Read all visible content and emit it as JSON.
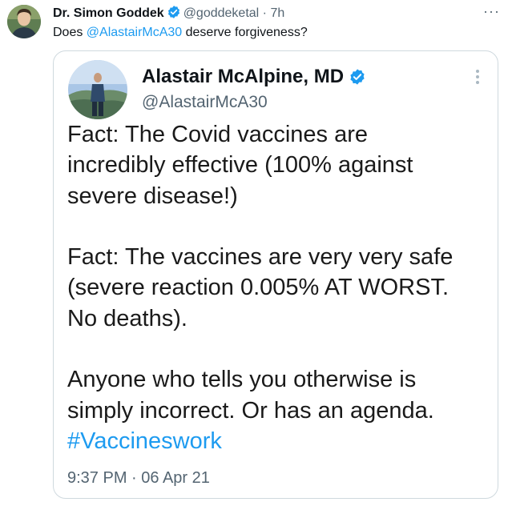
{
  "tweet": {
    "author_name": "Dr. Simon Goddek",
    "handle": "@goddeketal",
    "separator": "·",
    "time": "7h",
    "more_icon": "···",
    "text_before": "Does ",
    "mention": "@AlastairMcA30",
    "text_after": " deserve forgiveness?"
  },
  "quoted": {
    "author_name": "Alastair McAlpine, MD",
    "handle": "@AlastairMcA30",
    "paragraphs": [
      [
        "Fact: The Covid vaccines are",
        "incredibly effective (100% against",
        "severe disease!)"
      ],
      [
        "Fact: The vaccines are very very safe",
        "(severe reaction 0.005% AT WORST.",
        "No deaths)."
      ],
      [
        "Anyone who tells you otherwise is",
        "simply incorrect. Or has an agenda."
      ]
    ],
    "hashtag": "#Vaccineswork",
    "timestamp": "9:37 PM · 06 Apr 21"
  },
  "colors": {
    "verified": "#1d9bf0",
    "link": "#1d9bf0",
    "muted": "#536471"
  }
}
